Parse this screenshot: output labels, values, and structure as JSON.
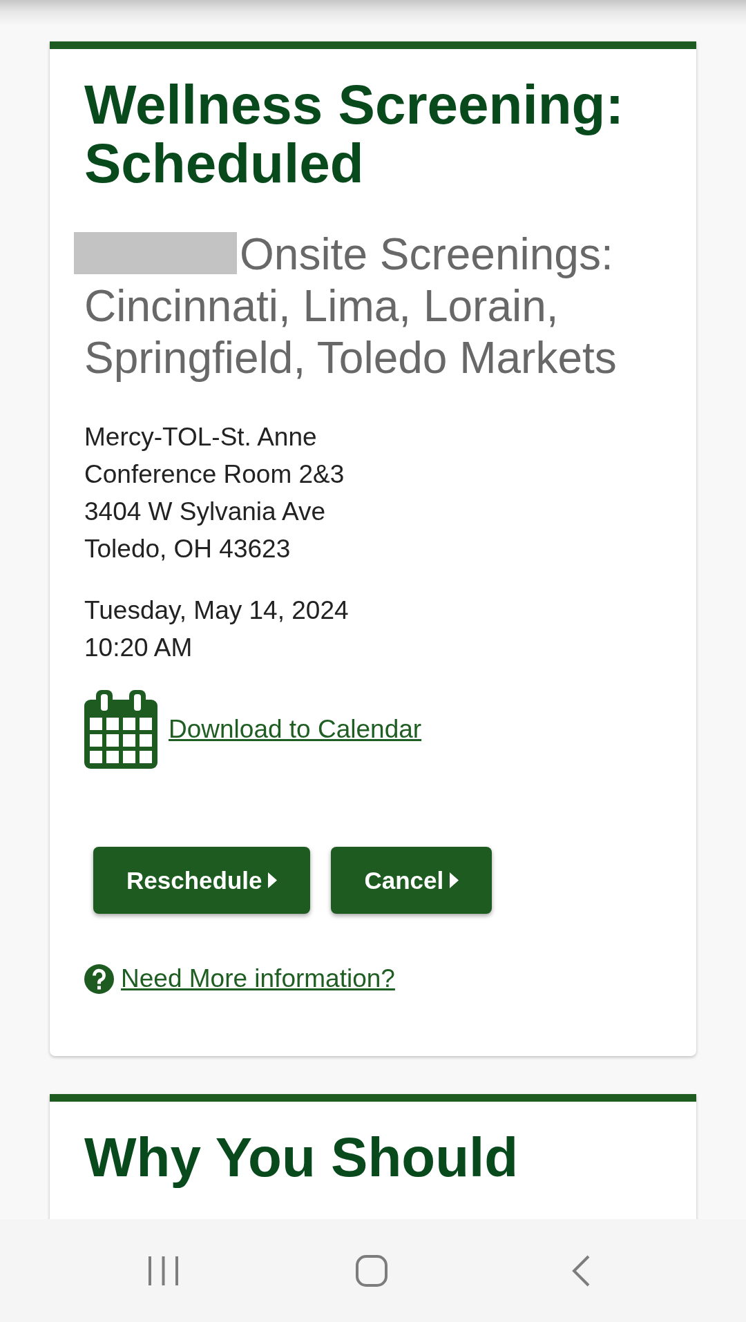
{
  "cards": [
    {
      "title": "Wellness Screening: Scheduled",
      "subtitle": {
        "redacted": true,
        "text": "Onsite Screenings: Cincinnati, Lima, Lorain, Springfield, Toledo Markets"
      },
      "address_lines": [
        "Mercy-TOL-St. Anne",
        "Conference Room 2&3",
        "3404 W Sylvania Ave",
        "Toledo, OH 43623"
      ],
      "appointment": {
        "date": "Tuesday, May 14, 2024",
        "time": "10:20 AM"
      },
      "calendar_link": "Download to Calendar",
      "buttons": [
        "Reschedule",
        "Cancel"
      ],
      "help_link": "Need More information?"
    },
    {
      "title": "Why You Should"
    }
  ]
}
